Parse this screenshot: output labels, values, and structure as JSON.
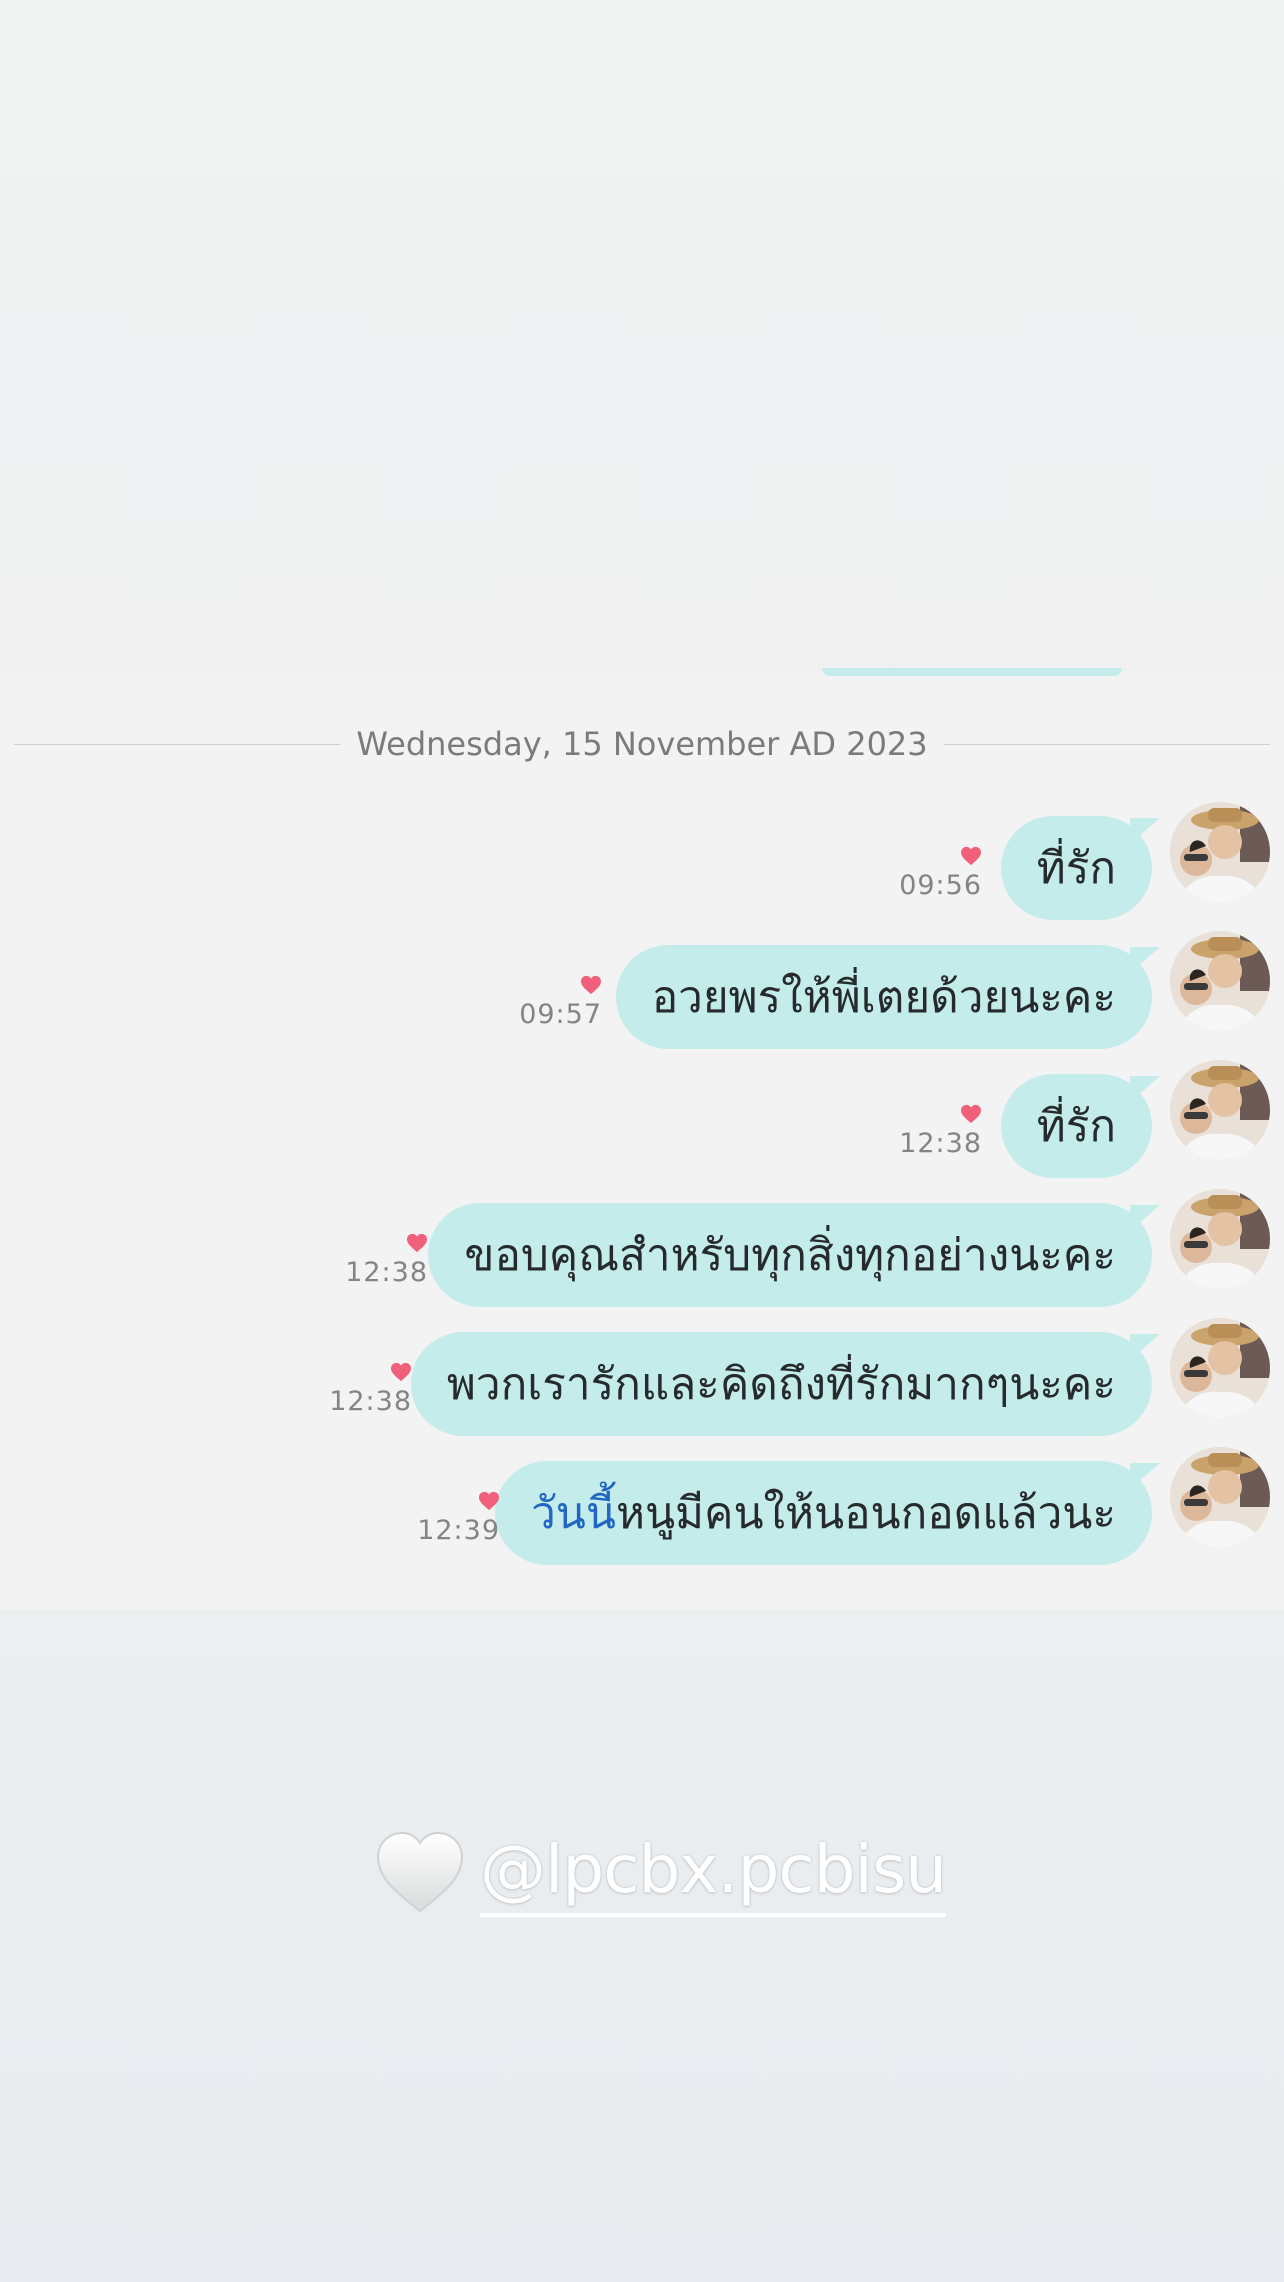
{
  "date_divider": "Wednesday, 15 November AD 2023",
  "messages": [
    {
      "text": "ที่รัก",
      "time": "09:56"
    },
    {
      "text": "อวยพรให้พี่เตยด้วยนะคะ",
      "time": "09:57"
    },
    {
      "text": "ที่รัก",
      "time": "12:38"
    },
    {
      "text": "ขอบคุณสำหรับทุกสิ่งทุกอย่างนะคะ",
      "time": "12:38"
    },
    {
      "text": "พวกเรารักและคิดถึงที่รักมากๆนะคะ",
      "time": "12:38"
    },
    {
      "text_link": "วันนี้",
      "text_rest": "หนูมีคนให้นอนกอดแล้วนะ",
      "time": "12:39"
    }
  ],
  "sticker": {
    "icon": "white-heart-icon",
    "mention": "@lpcbx.pcbisu"
  },
  "colors": {
    "bubble": "#c4ecea",
    "heart": "#f0607a",
    "link": "#2166c4"
  }
}
